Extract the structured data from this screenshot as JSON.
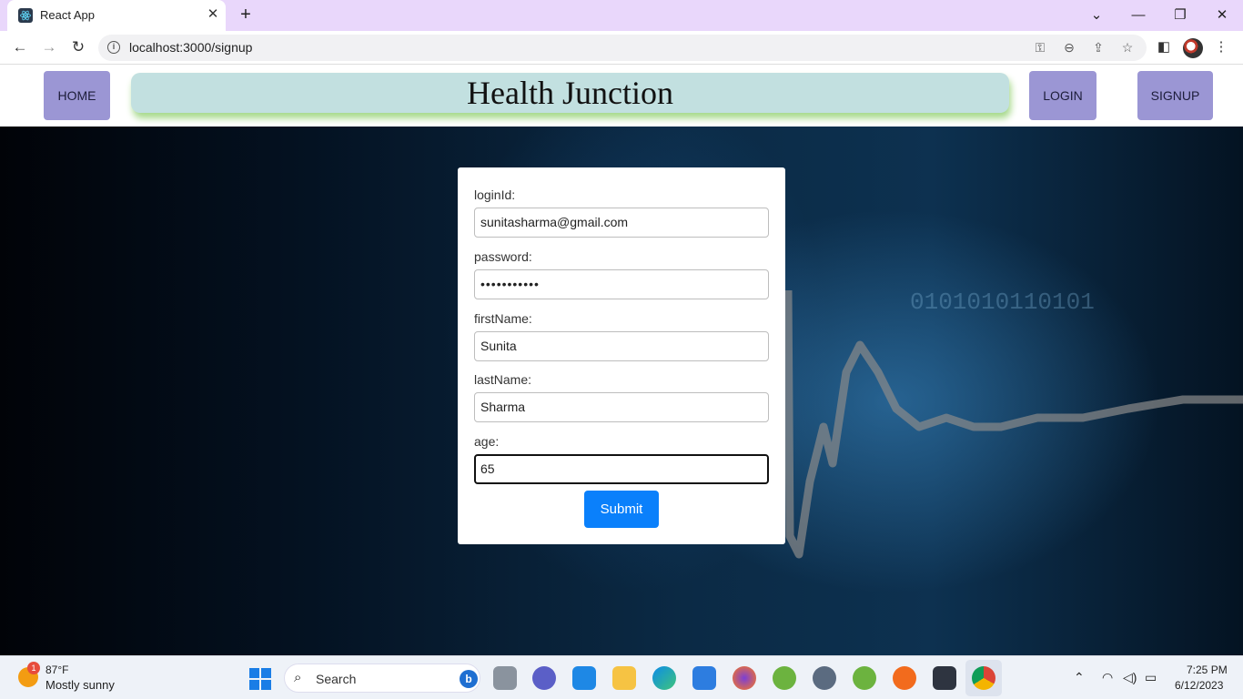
{
  "browser": {
    "tab_title": "React App",
    "url": "localhost:3000/signup"
  },
  "header": {
    "home": "HOME",
    "brand": "Health Junction",
    "login": "LOGIN",
    "signup": "SIGNUP"
  },
  "form": {
    "login_label": "loginId:",
    "login_value": "sunitasharma@gmail.com",
    "password_label": "password:",
    "password_value": "•••••••••••",
    "first_label": "firstName:",
    "first_value": "Sunita",
    "last_label": "lastName:",
    "last_value": "Sharma",
    "age_label": "age:",
    "age_value": "65",
    "submit": "Submit"
  },
  "taskbar": {
    "weather_badge": "1",
    "weather_temp": "87°F",
    "weather_desc": "Mostly sunny",
    "search": "Search",
    "time": "7:25 PM",
    "date": "6/12/2023"
  }
}
